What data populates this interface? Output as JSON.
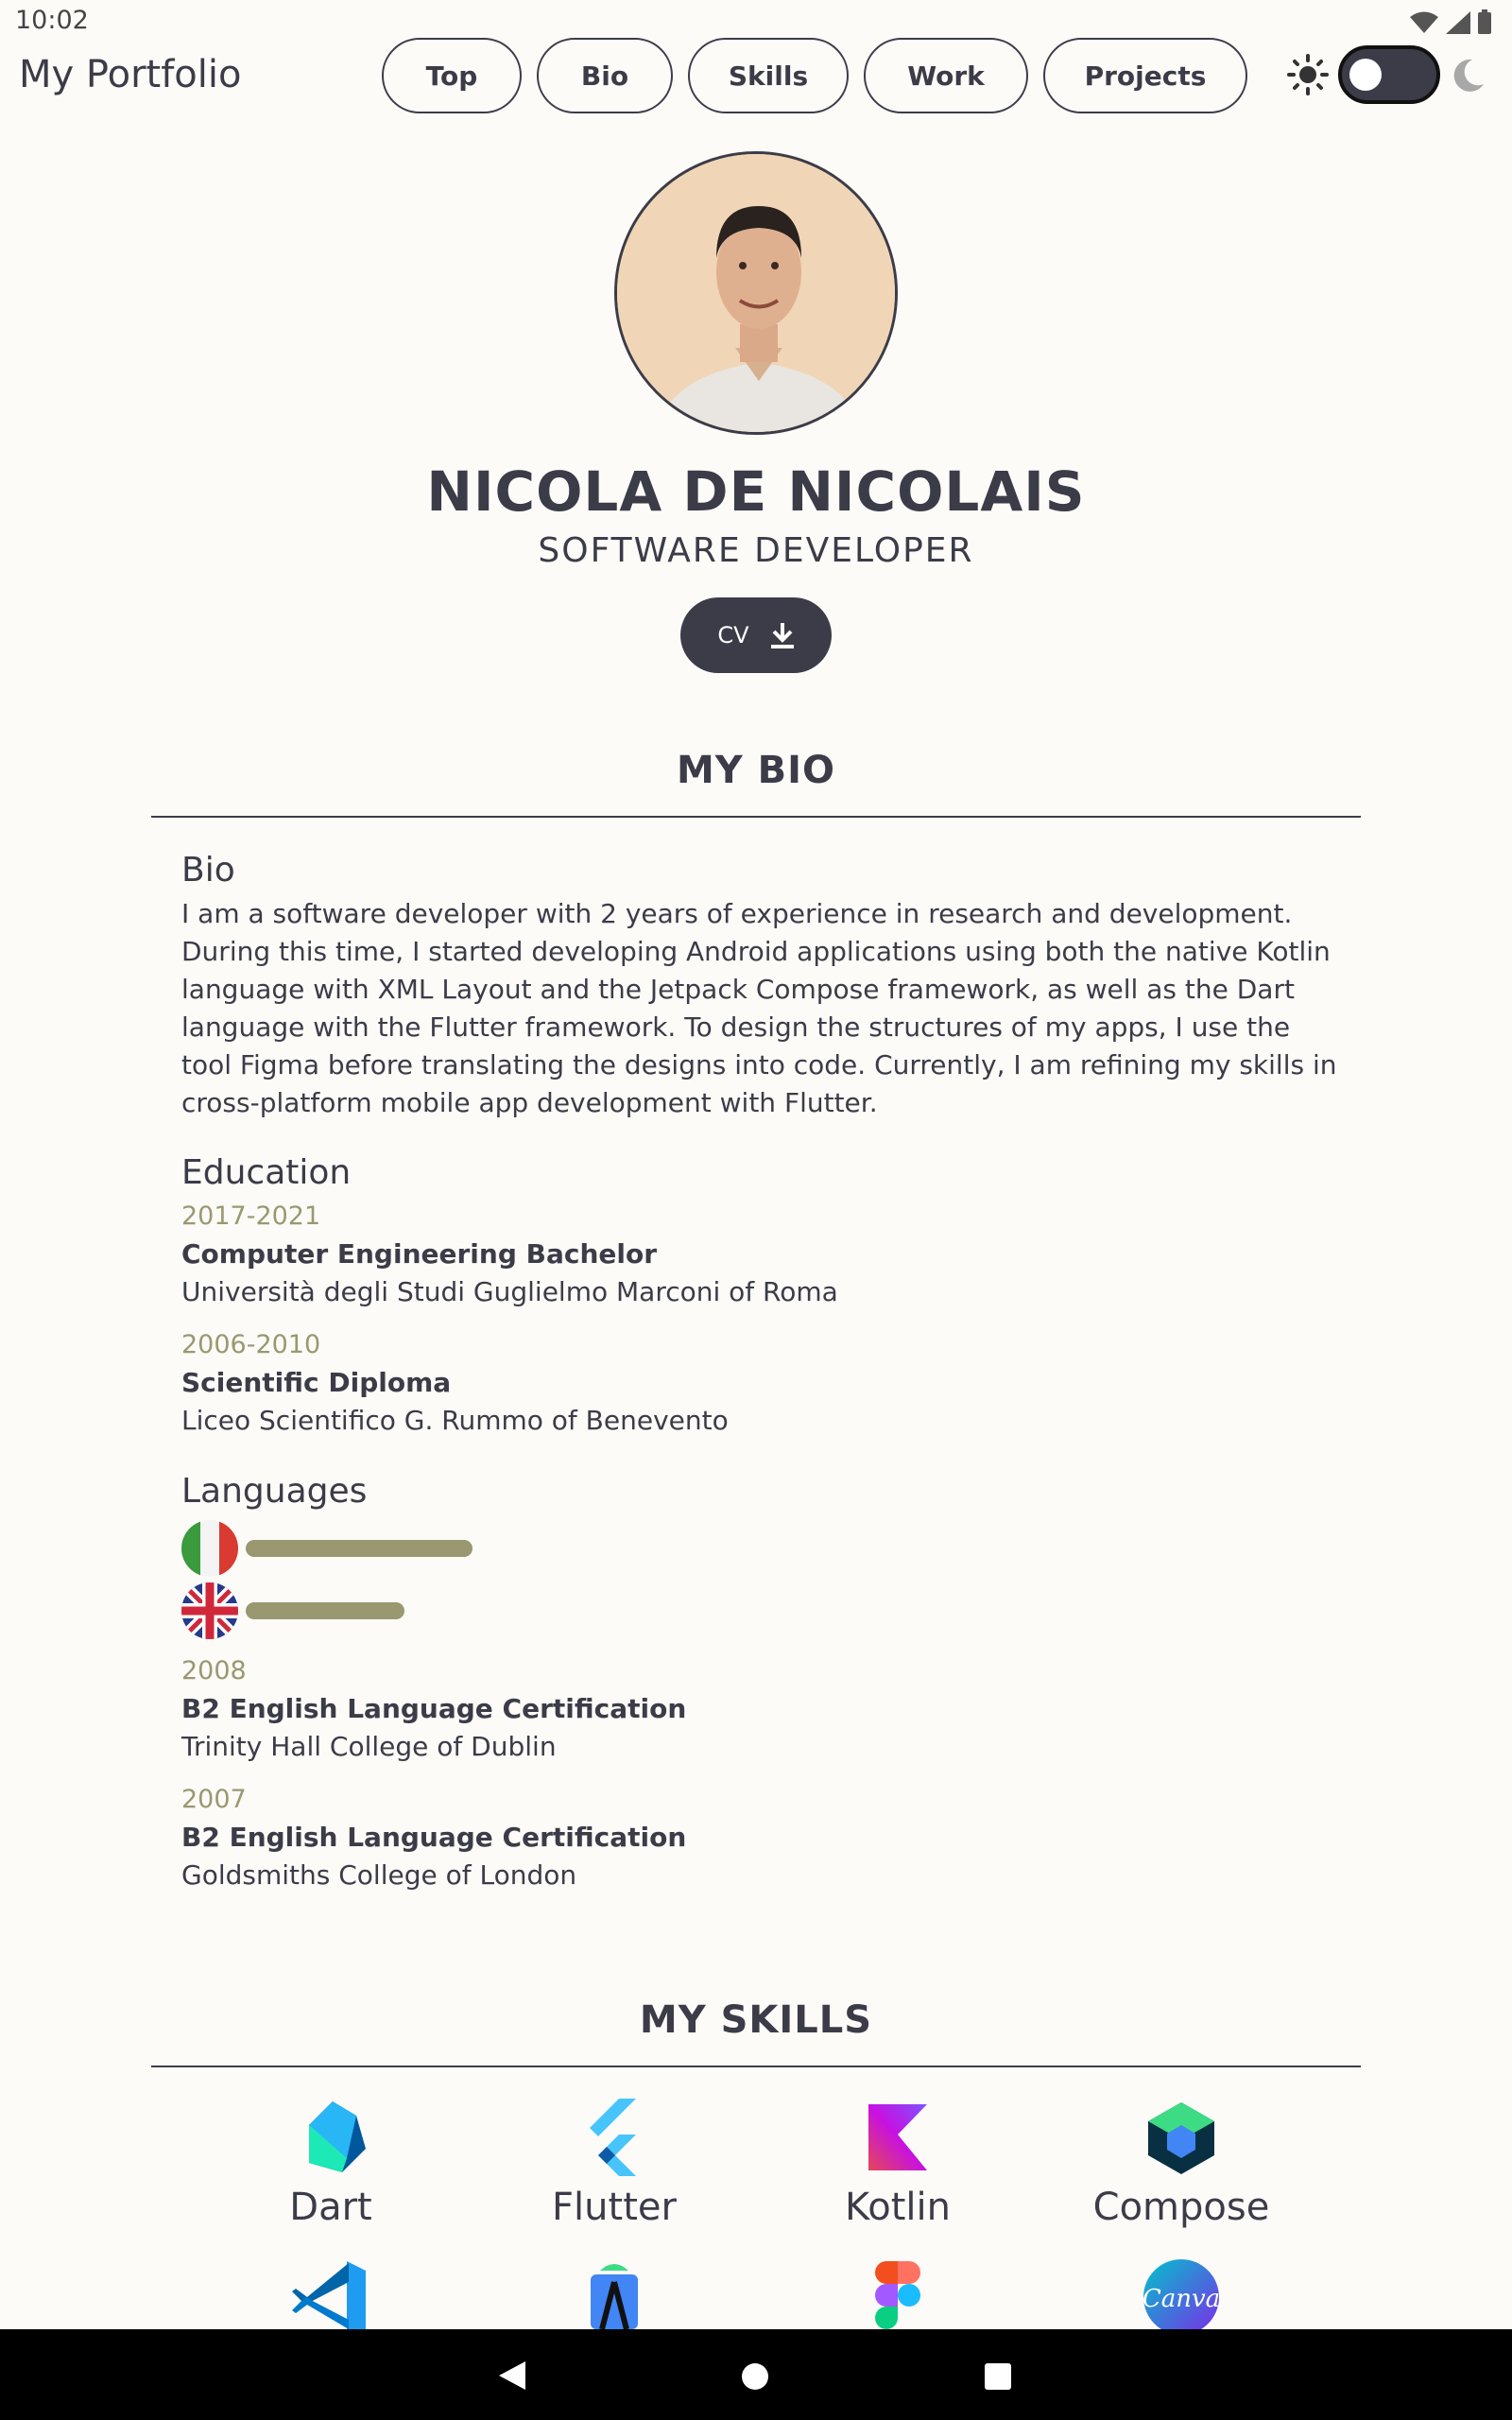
{
  "status_bar": {
    "time": "10:02"
  },
  "app_bar": {
    "title": "My Portfolio",
    "nav": [
      "Top",
      "Bio",
      "Skills",
      "Work",
      "Projects"
    ]
  },
  "hero": {
    "name": "NICOLA DE NICOLAIS",
    "role": "SOFTWARE DEVELOPER",
    "cv_label": "CV"
  },
  "bio_section": {
    "title": "MY BIO",
    "bio_heading": "Bio",
    "bio_text": "I am a software developer with 2 years of experience in research and development. During this time, I started developing Android applications using both the native Kotlin language with XML Layout and the Jetpack Compose framework, as well as the Dart language with the Flutter framework. To design the structures of my apps, I use the tool Figma before translating the designs into code. Currently, I am refining my skills in cross-platform mobile app development with Flutter.",
    "education_heading": "Education",
    "education": [
      {
        "years": "2017-2021",
        "title": "Computer Engineering Bachelor",
        "school": "Università degli Studi Guglielmo Marconi of Roma"
      },
      {
        "years": "2006-2010",
        "title": "Scientific Diploma",
        "school": "Liceo Scientifico G. Rummo of Benevento"
      }
    ],
    "languages_heading": "Languages",
    "languages": [
      {
        "flag": "italy-flag-icon",
        "level": 1.0
      },
      {
        "flag": "uk-flag-icon",
        "level": 0.7
      }
    ],
    "certifications": [
      {
        "year": "2008",
        "title": "B2 English Language Certification",
        "school": "Trinity Hall College of Dublin"
      },
      {
        "year": "2007",
        "title": "B2 English Language Certification",
        "school": "Goldsmiths College of London"
      }
    ]
  },
  "skills_section": {
    "title": "MY SKILLS",
    "skills": [
      {
        "label": "Dart",
        "icon": "dart-icon"
      },
      {
        "label": "Flutter",
        "icon": "flutter-icon"
      },
      {
        "label": "Kotlin",
        "icon": "kotlin-icon"
      },
      {
        "label": "Compose",
        "icon": "compose-icon"
      }
    ],
    "more_skill_icons": [
      "vscode-icon",
      "android-studio-icon",
      "figma-icon",
      "canva-icon"
    ],
    "canva_logo_text": "Canva"
  },
  "colors": {
    "background": "#fcfbf8",
    "primary": "#3c3c48",
    "accent": "#9a9870"
  }
}
